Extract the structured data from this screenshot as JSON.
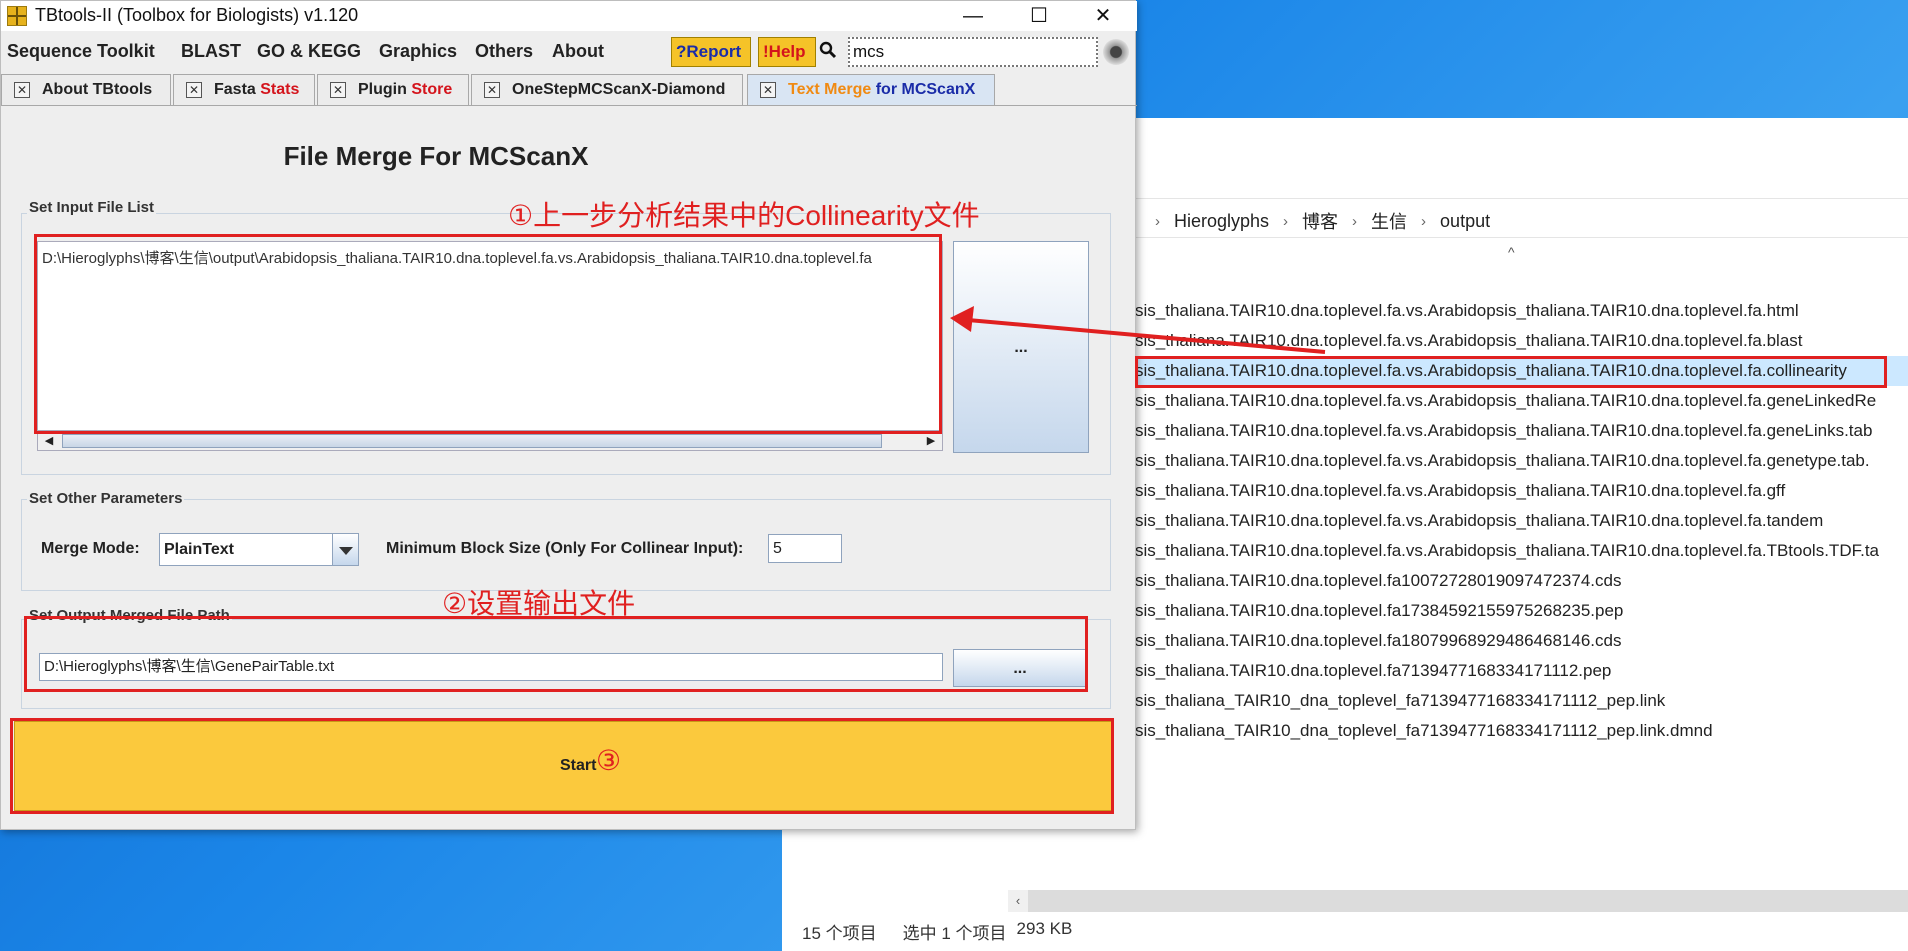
{
  "window": {
    "title": "TBtools-II (Toolbox for Biologists) v1.120",
    "minimize": "—",
    "maximize": "☐",
    "close": "✕"
  },
  "menu": [
    "Sequence Toolkit",
    "BLAST",
    "GO & KEGG",
    "Graphics",
    "Others",
    "About"
  ],
  "toolbar": {
    "report_label": "?Report",
    "help_label": "!Help",
    "search_value": "mcs"
  },
  "tabs": [
    {
      "parts": [
        "About TBtools"
      ]
    },
    {
      "parts": [
        "Fasta ",
        "Stats"
      ]
    },
    {
      "parts": [
        "Plugin ",
        "Store"
      ]
    },
    {
      "parts": [
        "OneStepMCScanX-Diamond"
      ]
    },
    {
      "parts": [
        "Text Merge",
        " for MCScanX"
      ]
    }
  ],
  "panel": {
    "title": "File Merge For MCScanX",
    "input_group_label": "Set Input File List",
    "input_value": "D:\\Hieroglyphs\\博客\\生信\\output\\Arabidopsis_thaliana.TAIR10.dna.toplevel.fa.vs.Arabidopsis_thaliana.TAIR10.dna.toplevel.fa",
    "browse_label": "...",
    "params_group_label": "Set Other Parameters",
    "merge_mode_label": "Merge Mode:",
    "merge_mode_value": "PlainText",
    "min_block_label": "Minimum Block Size (Only For Collinear Input):",
    "min_block_value": "5",
    "output_group_label": "Set Output Merged File Path",
    "output_value": "D:\\Hieroglyphs\\博客\\生信\\GenePairTable.txt",
    "start_label": "Start"
  },
  "annotations": {
    "step1": "①上一步分析结果中的Collinearity文件",
    "step2": "②设置输出文件",
    "step3": "③"
  },
  "explorer": {
    "breadcrumb": [
      "Hieroglyphs",
      "博客",
      "生信",
      "output"
    ],
    "breadcrumb_sep": "›",
    "sort_caret": "^",
    "files": [
      "sis_thaliana.TAIR10.dna.toplevel.fa.vs.Arabidopsis_thaliana.TAIR10.dna.toplevel.fa.html",
      "sis_thaliana.TAIR10.dna.toplevel.fa.vs.Arabidopsis_thaliana.TAIR10.dna.toplevel.fa.blast",
      "sis_thaliana.TAIR10.dna.toplevel.fa.vs.Arabidopsis_thaliana.TAIR10.dna.toplevel.fa.collinearity",
      "sis_thaliana.TAIR10.dna.toplevel.fa.vs.Arabidopsis_thaliana.TAIR10.dna.toplevel.fa.geneLinkedRe",
      "sis_thaliana.TAIR10.dna.toplevel.fa.vs.Arabidopsis_thaliana.TAIR10.dna.toplevel.fa.geneLinks.tab",
      "sis_thaliana.TAIR10.dna.toplevel.fa.vs.Arabidopsis_thaliana.TAIR10.dna.toplevel.fa.genetype.tab.",
      "sis_thaliana.TAIR10.dna.toplevel.fa.vs.Arabidopsis_thaliana.TAIR10.dna.toplevel.fa.gff",
      "sis_thaliana.TAIR10.dna.toplevel.fa.vs.Arabidopsis_thaliana.TAIR10.dna.toplevel.fa.tandem",
      "sis_thaliana.TAIR10.dna.toplevel.fa.vs.Arabidopsis_thaliana.TAIR10.dna.toplevel.fa.TBtools.TDF.ta",
      "sis_thaliana.TAIR10.dna.toplevel.fa10072728019097472374.cds",
      "sis_thaliana.TAIR10.dna.toplevel.fa17384592155975268235.pep",
      "sis_thaliana.TAIR10.dna.toplevel.fa18079968929486468146.cds",
      "sis_thaliana.TAIR10.dna.toplevel.fa7139477168334171112.pep",
      "sis_thaliana_TAIR10_dna_toplevel_fa7139477168334171112_pep.link",
      "sis_thaliana_TAIR10_dna_toplevel_fa7139477168334171112_pep.link.dmnd"
    ],
    "selected_index": 2,
    "status_count": "15 个项目",
    "status_selected": "选中 1 个项目",
    "status_size": "293 KB"
  },
  "colors": {
    "annotation": "#e02020",
    "start_button": "#fbc93d",
    "selection": "#cce8ff",
    "accent_red": "#d4141c",
    "accent_blue": "#1a2ca8",
    "accent_orange": "#f08a12"
  }
}
